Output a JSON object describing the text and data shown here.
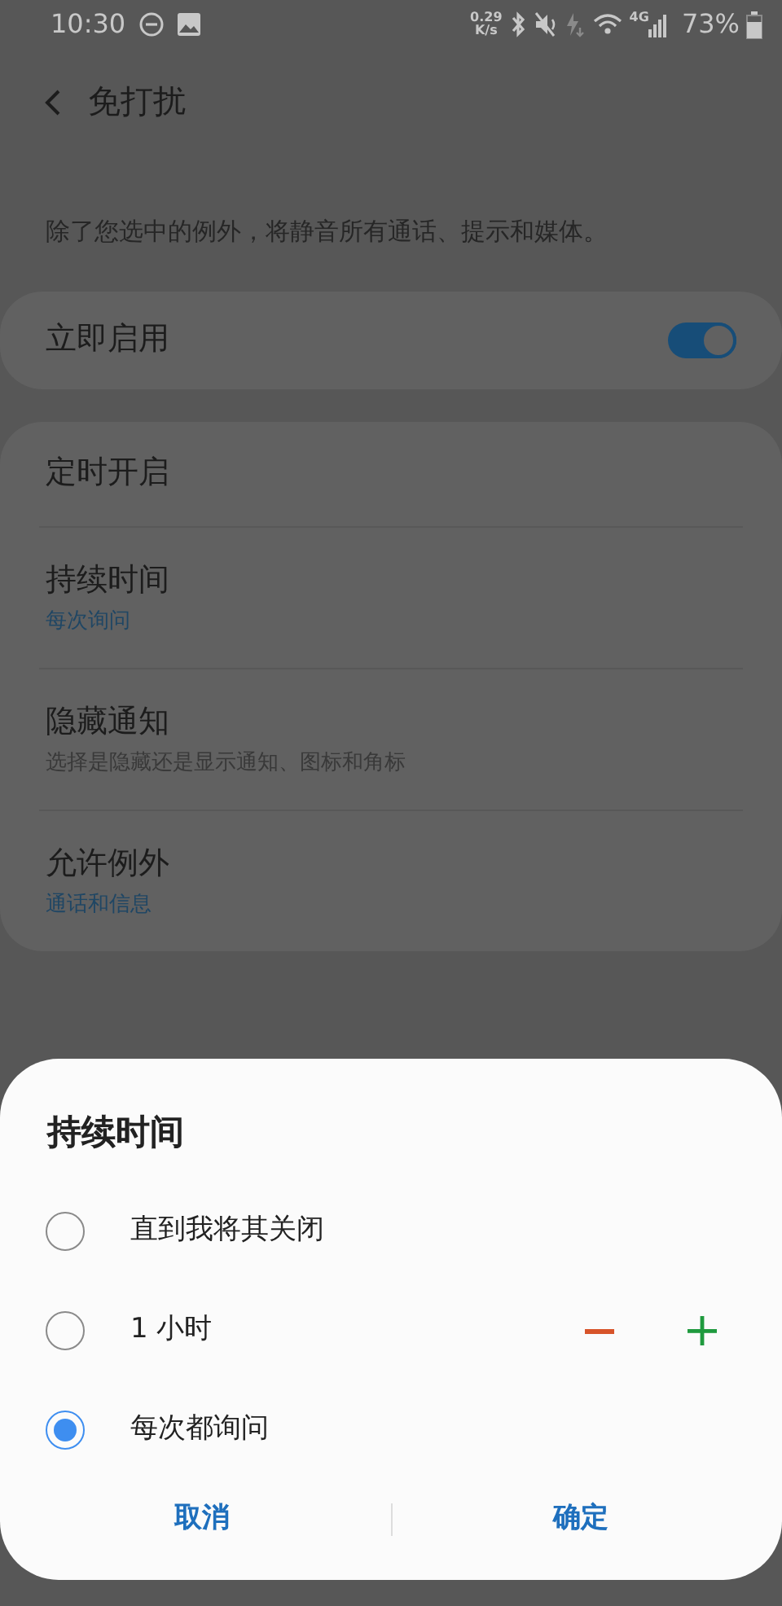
{
  "status_bar": {
    "time": "10:30",
    "net_speed": "0.29",
    "net_unit": "K/s",
    "network": "4G",
    "battery": "73%"
  },
  "header": {
    "title": "免打扰"
  },
  "description": "除了您选中的例外，将静音所有通话、提示和媒体。",
  "instant": {
    "label": "立即启用",
    "on": true
  },
  "settings": [
    {
      "label": "定时开启"
    },
    {
      "label": "持续时间",
      "subtitle": "每次询问",
      "kind": "accent"
    },
    {
      "label": "隐藏通知",
      "subtitle": "选择是隐藏还是显示通知、图标和角标",
      "kind": "muted"
    },
    {
      "label": "允许例外",
      "subtitle": "通话和信息",
      "kind": "accent"
    }
  ],
  "dialog": {
    "title": "持续时间",
    "options": [
      {
        "label": "直到我将其关闭",
        "selected": false,
        "kind": "plain"
      },
      {
        "label": "1 小时",
        "selected": false,
        "kind": "stepper"
      },
      {
        "label": "每次都询问",
        "selected": true,
        "kind": "plain"
      }
    ],
    "buttons": [
      "取消",
      "确定"
    ]
  }
}
